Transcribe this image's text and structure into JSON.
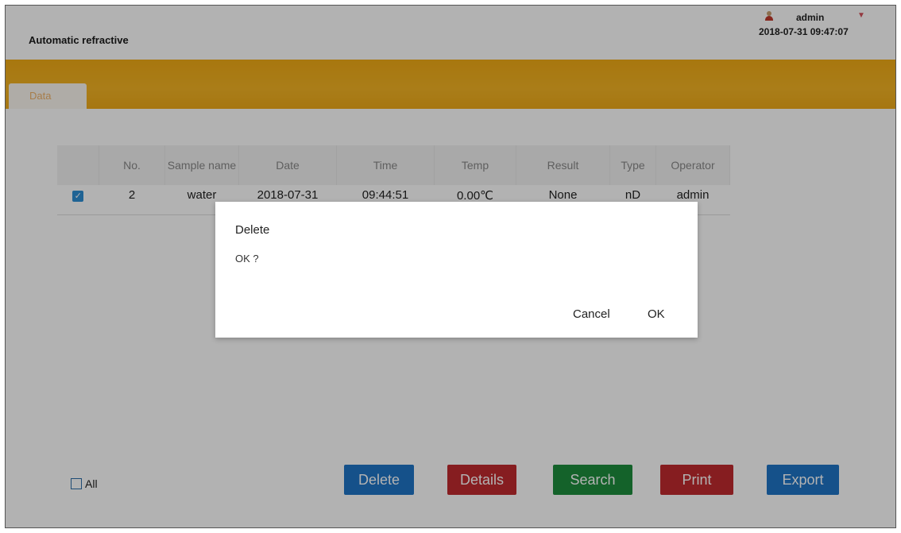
{
  "header": {
    "app_title": "Automatic refractive",
    "user_name": "admin",
    "datetime": "2018-07-31 09:47:07"
  },
  "tabs": [
    {
      "label": "Data"
    }
  ],
  "table": {
    "columns": [
      "",
      "No.",
      "Sample name",
      "Date",
      "Time",
      "Temp",
      "Result",
      "Type",
      "Operator"
    ],
    "rows": [
      {
        "checked": true,
        "no": "2",
        "sample_name": "water",
        "date": "2018-07-31",
        "time": "09:44:51",
        "temp": "0.00℃",
        "result": "None",
        "type": "nD",
        "operator": "admin"
      }
    ]
  },
  "select_all_label": "All",
  "buttons": {
    "delete": "Delete",
    "details": "Details",
    "search": "Search",
    "print": "Print",
    "export": "Export"
  },
  "dialog": {
    "title": "Delete",
    "message": "OK ?",
    "cancel_label": "Cancel",
    "ok_label": "OK"
  },
  "colors": {
    "header_band": "#f1ab16",
    "delete_button": "#1f74c6",
    "details_button": "#c02a2e",
    "search_button": "#1e8d3d",
    "print_button": "#c02a2e",
    "export_button": "#1f74c6",
    "checkbox_checked": "#2d8fd5"
  },
  "icons": {
    "avatar": "user-avatar-icon",
    "menu": "dropdown-menu-icon",
    "checkbox": "checkbox-checked-icon"
  }
}
